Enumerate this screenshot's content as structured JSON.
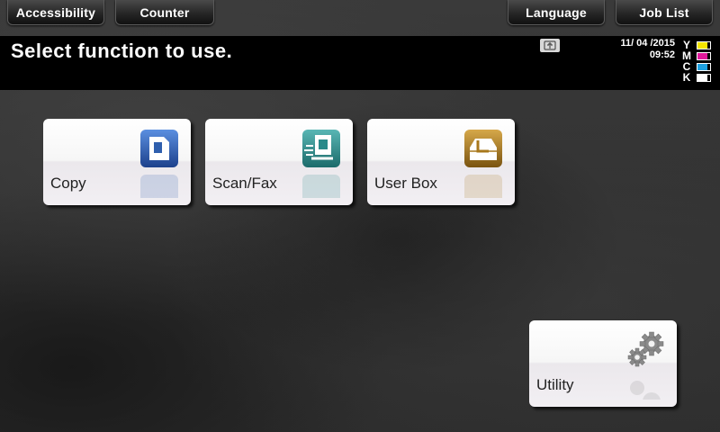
{
  "top_buttons": {
    "accessibility": "Accessibility",
    "counter": "Counter",
    "language": "Language",
    "job_list": "Job List"
  },
  "header": {
    "title": "Select function to use.",
    "date": "11/ 04 /2015",
    "time": "09:52",
    "toner": [
      {
        "letter": "Y",
        "color": "#f5e600",
        "level": 0.8
      },
      {
        "letter": "M",
        "color": "#e0199a",
        "level": 0.8
      },
      {
        "letter": "C",
        "color": "#1da1e0",
        "level": 0.8
      },
      {
        "letter": "K",
        "color": "#ffffff",
        "level": 0.8
      }
    ]
  },
  "tiles": {
    "copy": {
      "label": "Copy",
      "icon": "copy-icon",
      "color": "#2f5fae"
    },
    "scan_fax": {
      "label": "Scan/Fax",
      "icon": "scan-fax-icon",
      "color": "#2a8a8a"
    },
    "user_box": {
      "label": "User Box",
      "icon": "user-box-icon",
      "color": "#a8781c"
    },
    "utility": {
      "label": "Utility",
      "icon": "gear-icon",
      "color": "#888888"
    }
  }
}
